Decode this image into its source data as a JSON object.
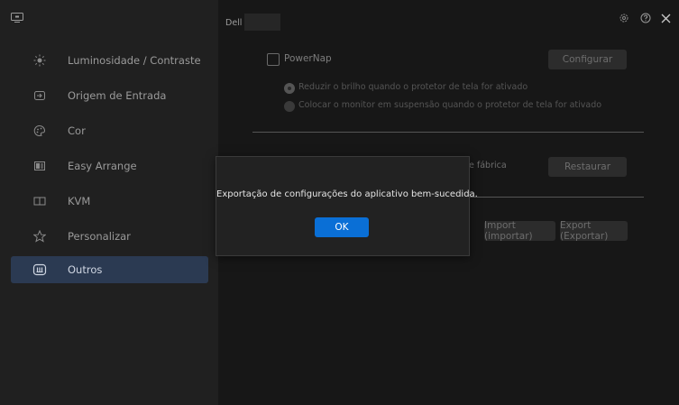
{
  "header": {
    "brand_label": "Dell"
  },
  "sidebar": {
    "items": [
      {
        "label": "Luminosidade / Contraste",
        "icon": "brightness-icon"
      },
      {
        "label": "Origem de Entrada",
        "icon": "input-source-icon"
      },
      {
        "label": "Cor",
        "icon": "color-icon"
      },
      {
        "label": "Easy Arrange",
        "icon": "easy-arrange-icon"
      },
      {
        "label": "KVM",
        "icon": "kvm-icon"
      },
      {
        "label": "Personalizar",
        "icon": "star-icon"
      },
      {
        "label": "Outros",
        "icon": "others-icon",
        "active": true
      }
    ]
  },
  "main": {
    "powernap_label": "PowerNap",
    "configure_button": "Configurar",
    "radio_dim": "Reduzir o brilho quando o protetor de tela for ativado",
    "radio_sleep": "Colocar o monitor em suspensão quando o protetor de tela for ativado",
    "factory_partial": "de fábrica",
    "restore_button": "Restaurar",
    "import_button": "Import (importar)",
    "export_button": "Export (Exportar)"
  },
  "dialog": {
    "message": "Exportação de configurações do aplicativo bem-sucedida.",
    "ok_label": "OK"
  },
  "colors": {
    "accent": "#0a6fd6",
    "active_nav": "#2b3a52"
  }
}
